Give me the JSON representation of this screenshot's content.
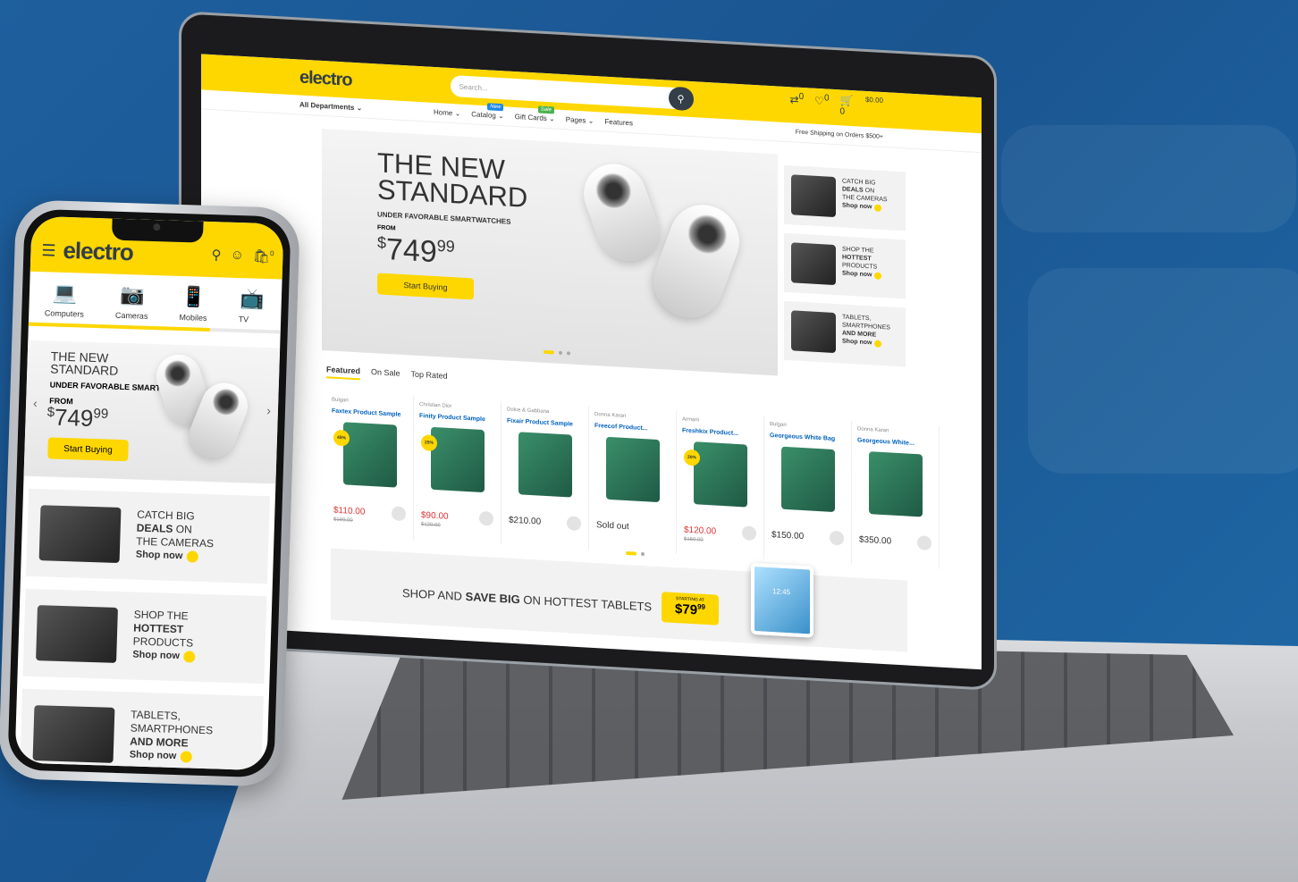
{
  "brand": {
    "logo": "electro",
    "accent": "#fed700",
    "dark": "#333e48",
    "background": "#1e5f9e"
  },
  "laptop": {
    "search_placeholder": "Search...",
    "cart_total": "$0.00",
    "header_counts": [
      "0",
      "0",
      "0"
    ],
    "departments": "All Departments",
    "nav": [
      "Home",
      "Catalog",
      "Gift Cards",
      "Pages",
      "Features"
    ],
    "badges": {
      "catalog": "New",
      "gift": "Sale"
    },
    "shipping": "Free Shipping on Orders $500+",
    "hero": {
      "title_line1": "THE NEW",
      "title_line2": "STANDARD",
      "subtitle": "UNDER FAVORABLE SMARTWATCHES",
      "from": "FROM",
      "currency": "$",
      "price_main": "749",
      "price_cents": "99",
      "button": "Start Buying"
    },
    "side_banners": [
      {
        "l1": "CATCH BIG",
        "l2": "DEALS",
        "l2b": " ON",
        "l3": "THE CAMERAS",
        "shop": "Shop now"
      },
      {
        "l1": "SHOP THE",
        "l2": "HOTTEST",
        "l2b": "",
        "l3": "PRODUCTS",
        "shop": "Shop now"
      },
      {
        "l1": "TABLETS,",
        "l2": "SMARTPHONES",
        "l2b": "",
        "l3": "AND MORE",
        "shop": "Shop now"
      }
    ],
    "tabs": [
      "Featured",
      "On Sale",
      "Top Rated"
    ],
    "products": [
      {
        "brand": "Bulgari",
        "name": "Faxtex Product Sample",
        "discount": "45%",
        "price": "$110.00",
        "old": "$199.00"
      },
      {
        "brand": "Christian Dior",
        "name": "Finity Product Sample",
        "discount": "25%",
        "price": "$90.00",
        "old": "$120.00"
      },
      {
        "brand": "Dolce & Gabbana",
        "name": "Fixair Product Sample",
        "discount": "",
        "price": "$210.00",
        "old": ""
      },
      {
        "brand": "Donna Karan",
        "name": "Freecof Product...",
        "discount": "",
        "price": "Sold out",
        "old": ""
      },
      {
        "brand": "Armani",
        "name": "Freshkix Product...",
        "discount": "20%",
        "price": "$120.00",
        "old": "$150.00"
      },
      {
        "brand": "Bulgari",
        "name": "Georgeous White Bag",
        "discount": "",
        "price": "$150.00",
        "old": ""
      },
      {
        "brand": "Donna Karan",
        "name": "Georgeous White...",
        "discount": "",
        "price": "$350.00",
        "old": ""
      }
    ],
    "banner": {
      "pre": "SHOP AND ",
      "bold": "SAVE BIG",
      "post": " ON HOTTEST TABLETS",
      "starting": "STARTING AT",
      "price": "$79",
      "cents": "99",
      "tablet_time": "12:45"
    }
  },
  "phone": {
    "cart_count": "0",
    "categories": [
      "Computers",
      "Cameras",
      "Mobiles",
      "TV"
    ],
    "hero": {
      "title_line1": "THE NEW",
      "title_line2": "STANDARD",
      "subtitle": "UNDER FAVORABLE SMARTWATCHES",
      "from": "FROM",
      "currency": "$",
      "price_main": "749",
      "price_cents": "99",
      "button": "Start Buying"
    },
    "cards": [
      {
        "l1": "CATCH BIG",
        "l2": "DEALS",
        "l2b": " ON",
        "l3": "THE CAMERAS",
        "shop": "Shop now"
      },
      {
        "l1": "SHOP THE",
        "l2": "HOTTEST",
        "l2b": "",
        "l3": "PRODUCTS",
        "shop": "Shop now"
      },
      {
        "l1": "TABLETS,",
        "l2": "SMARTPHONES",
        "l2b": "",
        "l3": "AND MORE",
        "shop": "Shop now"
      }
    ]
  }
}
